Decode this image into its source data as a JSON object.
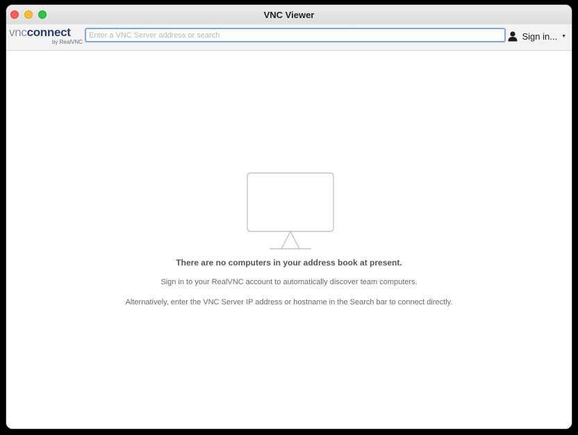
{
  "window": {
    "title": "VNC Viewer"
  },
  "toolbar": {
    "logo": {
      "vnc": "vnc",
      "connect": "connect",
      "byline": "by RealVNC"
    },
    "search": {
      "value": "",
      "placeholder": "Enter a VNC Server address or search"
    },
    "signin": {
      "label": "Sign in...",
      "icon": "user-icon",
      "caret_icon": "chevron-down-icon"
    }
  },
  "empty_state": {
    "icon": "monitor-icon",
    "heading": "There are no computers in your address book at present.",
    "line1": "Sign in to your RealVNC account to automatically discover team computers.",
    "line2": "Alternatively, enter the VNC Server IP address or hostname in the Search bar to connect directly."
  },
  "colors": {
    "close": "#ff5f57",
    "minimize": "#febc2e",
    "maximize": "#28c840",
    "search_focus": "#7aa7e8",
    "logo_connect": "#2c3e6e"
  }
}
